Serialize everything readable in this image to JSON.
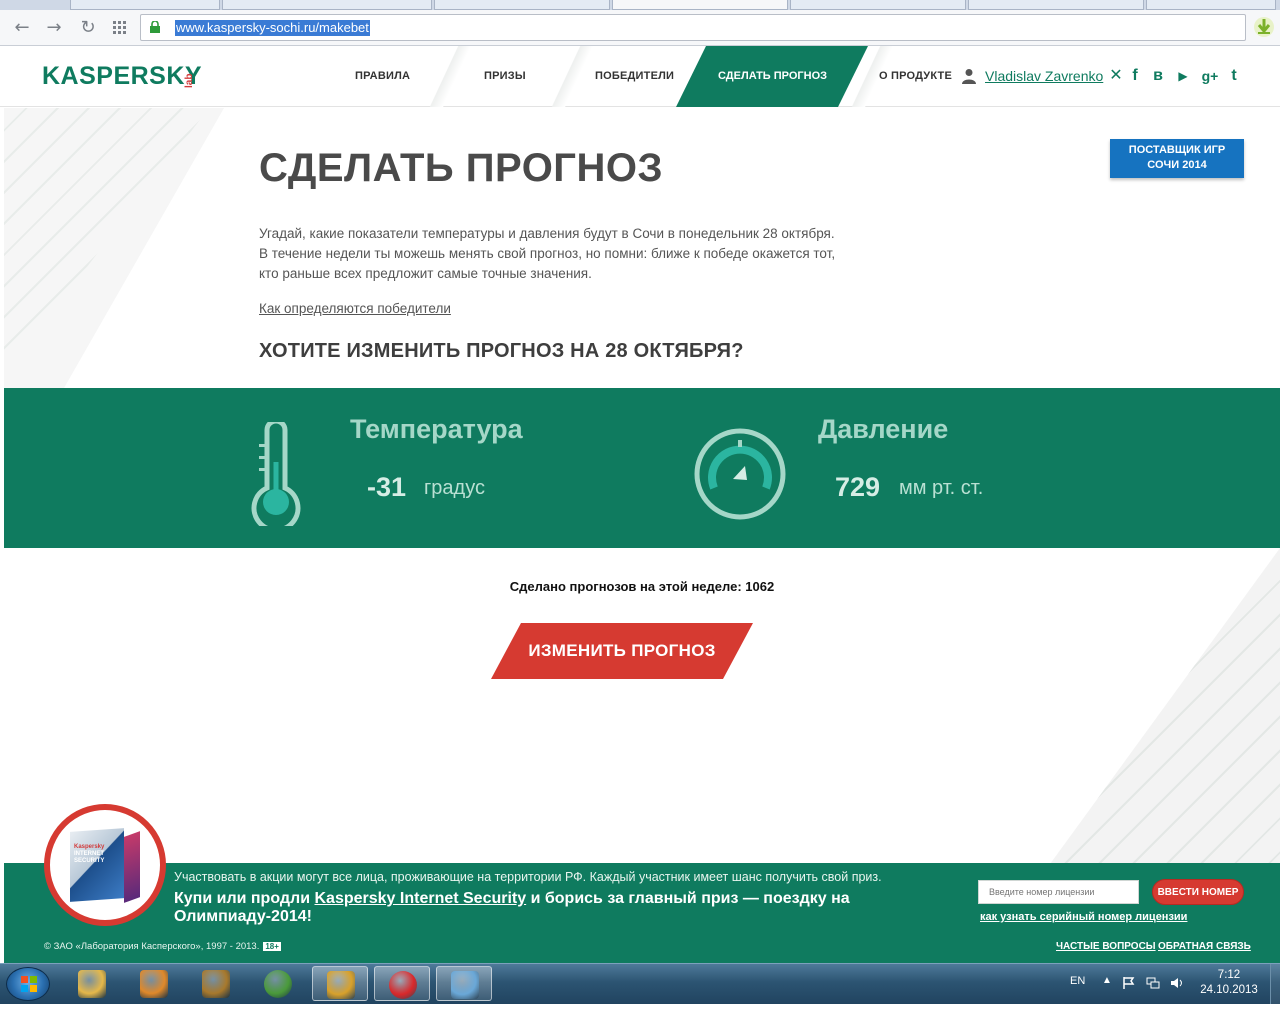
{
  "browser": {
    "url": "www.kaspersky-sochi.ru/makebet",
    "back_icon": "arrow-left-icon",
    "forward_icon": "arrow-right-icon",
    "reload_icon": "reload-icon",
    "apps_icon": "apps-grid-icon"
  },
  "header": {
    "logo": "KASPERSKY",
    "logo_suffix": "lab",
    "nav": {
      "rules": "ПРАВИЛА",
      "prizes": "ПРИЗЫ",
      "winners": "ПОБЕДИТЕЛИ",
      "make_forecast": "СДЕЛАТЬ ПРОГНОЗ",
      "about": "О ПРОДУКТЕ"
    },
    "user": "Vladislav Zavrenko",
    "social": {
      "x": "✕",
      "facebook": "f",
      "vk": "в",
      "youtube": "▶",
      "gplus": "g+",
      "twitter": "t"
    }
  },
  "hero": {
    "title": "СДЕЛАТЬ ПРОГНОЗ",
    "intro_lines": [
      "Угадай, какие показатели температуры и давления будут в Сочи в понедельник 28 октября.",
      "В течение недели ты можешь менять свой прогноз, но помни: ближе к победе окажется тот,",
      "кто раньше всех предложит самые точные значения."
    ],
    "how_link": "Как определяются победители",
    "change_question": "ХОТИТЕ ИЗМЕНИТЬ ПРОГНОЗ НА 28 ОКТЯБРЯ?",
    "supplier_line1": "ПОСТАВЩИК ИГР",
    "supplier_line2": "СОЧИ 2014"
  },
  "forecast": {
    "temperature_label": "Температура",
    "temperature_value": "-31",
    "temperature_unit": "градус",
    "pressure_label": "Давление",
    "pressure_value": "729",
    "pressure_unit": "мм рт. ст."
  },
  "stats": {
    "count_text": "Сделано прогнозов на этой неделе: 1062"
  },
  "cta": {
    "label": "ИЗМЕНИТЬ ПРОГНОЗ"
  },
  "footer": {
    "box_brand": "Kaspersky",
    "box_line1": "INTERNET",
    "box_line2": "SECURITY",
    "promo_small": "Участвовать в акции могут все лица, проживающие на территории РФ. Каждый участник имеет шанс получить свой приз.",
    "promo_pre": "Купи или продли ",
    "promo_link": "Kaspersky Internet Security",
    "promo_post": " и борись за главный приз — поездку на",
    "promo_line2": "Олимпиаду-2014!",
    "license_placeholder": "Введите номер лицензии",
    "license_button": "ВВЕСТИ НОМЕР",
    "license_link": "как узнать серийный номер лицензии",
    "copyright": "© ЗАО «Лаборатория Касперского», 1997 - 2013.",
    "age": "18+",
    "faq": "ЧАСТЫЕ ВОПРОСЫ",
    "feedback": "ОБРАТНАЯ СВЯЗЬ"
  },
  "taskbar": {
    "language": "EN",
    "time": "7:12",
    "date": "24.10.2013",
    "items": [
      {
        "icon": "explorer-icon",
        "color": "#e5b84a"
      },
      {
        "icon": "media-player-icon",
        "color": "#e0892a"
      },
      {
        "icon": "warcraft-icon",
        "color": "#a8792c"
      },
      {
        "icon": "chrome-icon",
        "color": "#4a9a3a"
      },
      {
        "icon": "winamp-icon",
        "color": "#d8a12b"
      },
      {
        "icon": "opera-icon",
        "color": "#d9282a"
      },
      {
        "icon": "paint-icon",
        "color": "#6aa8d8"
      }
    ]
  },
  "colors": {
    "brand_green": "#0f7b5f",
    "cta_red": "#d63a31",
    "supplier_blue": "#1673c0"
  }
}
